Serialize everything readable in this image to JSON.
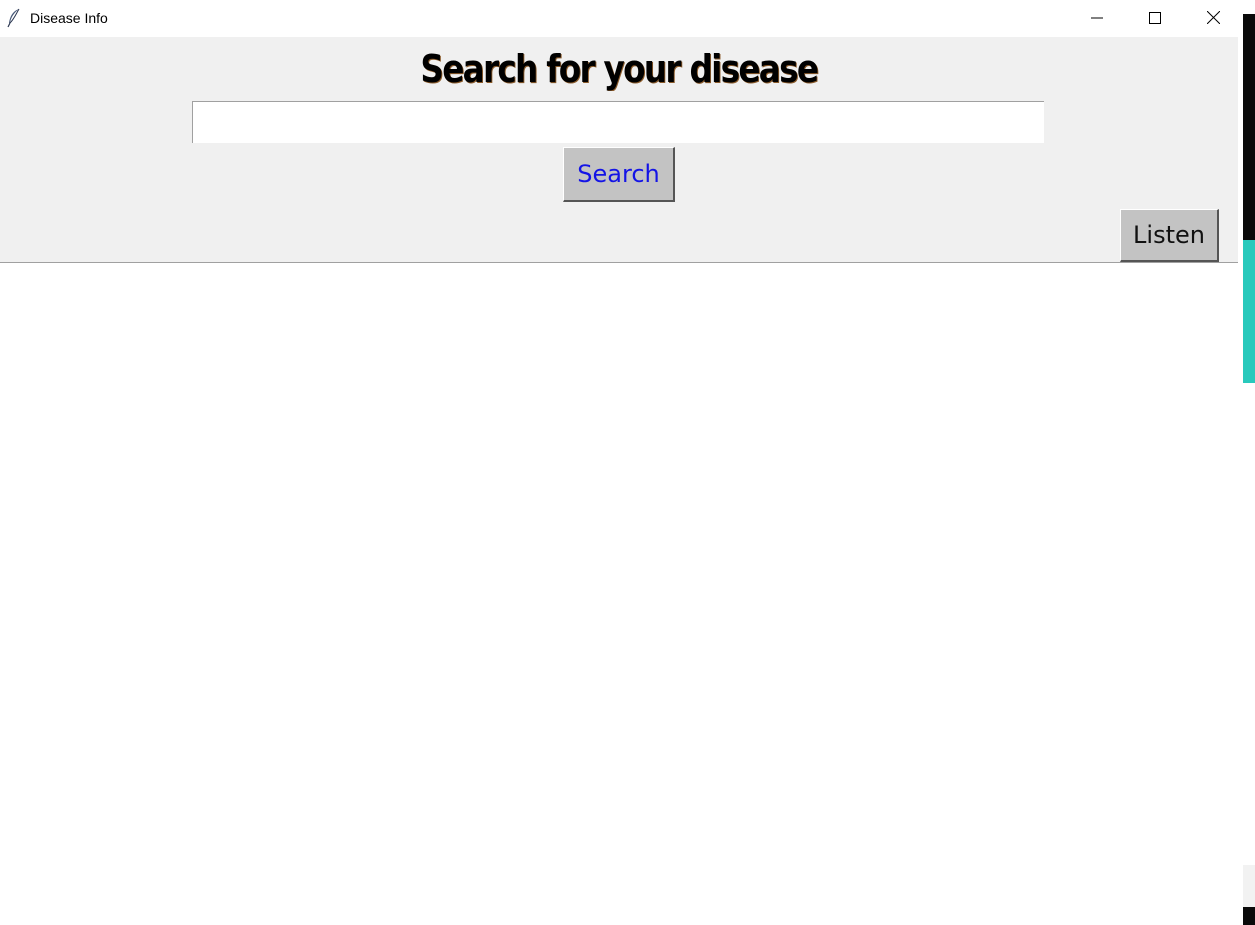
{
  "window": {
    "title": "Disease Info",
    "icon": "feather-icon"
  },
  "window_controls": {
    "minimize_icon": "minimize-icon",
    "maximize_icon": "maximize-icon",
    "close_icon": "close-icon"
  },
  "header": {
    "title": "Search for your disease"
  },
  "search": {
    "value": "",
    "button_label": "Search",
    "button_text_color": "#1414e6"
  },
  "listen": {
    "button_label": "Listen"
  },
  "colors": {
    "panel_background": "#f0f0f0",
    "button_background": "#c3c3c3",
    "desktop_accent": "#29c9bc"
  }
}
